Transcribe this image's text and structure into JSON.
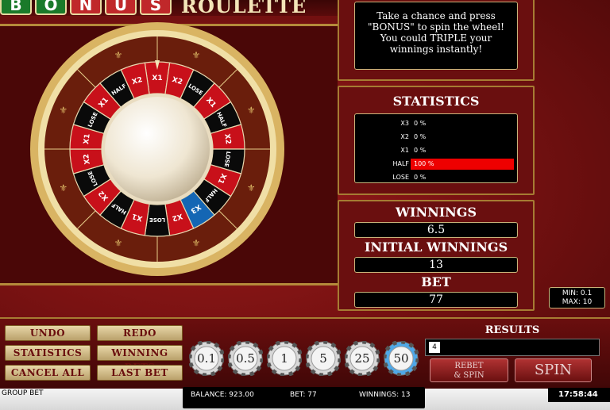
{
  "game": {
    "logo_letters": [
      "B",
      "O",
      "N",
      "U",
      "S"
    ],
    "logo_colors": [
      "#1a7a2a",
      "#1a7a2a",
      "#c0282a",
      "#c0282a",
      "#c0282a"
    ],
    "logo_text": "ROULETTE"
  },
  "wheel": {
    "segments": [
      "X1",
      "X2",
      "LOSE",
      "X1",
      "HALF",
      "X2",
      "LOSE",
      "X1",
      "HALF",
      "X3",
      "X2",
      "LOSE",
      "X1",
      "HALF",
      "X2",
      "LOSE",
      "X2",
      "X1",
      "LOSE",
      "X1",
      "HALF",
      "X2"
    ],
    "colors": {
      "X1": "#c8101a",
      "X2": "#c8101a",
      "X3": "#1466b4",
      "LOSE": "#0a0a0a",
      "HALF": "#0a0a0a"
    }
  },
  "message": "Take a chance and press \"BONUS\" to spin the wheel! You could TRIPLE your winnings instantly!",
  "statistics": {
    "title": "STATISTICS",
    "rows": [
      {
        "label": "X3",
        "value": "0 %",
        "fraction": 0
      },
      {
        "label": "X2",
        "value": "0 %",
        "fraction": 0
      },
      {
        "label": "X1",
        "value": "0 %",
        "fraction": 0
      },
      {
        "label": "HALF",
        "value": "100 %",
        "fraction": 1
      },
      {
        "label": "LOSE",
        "value": "0 %",
        "fraction": 0
      }
    ]
  },
  "winnings": {
    "title": "WINNINGS",
    "value": "6.5",
    "initial_title": "INITIAL WINNINGS",
    "initial_value": "13",
    "bet_title": "BET",
    "bet_value": "77"
  },
  "limits": {
    "min": "MIN: 0.1",
    "max": "MAX: 10"
  },
  "controls": {
    "undo": "UNDO",
    "redo": "REDO",
    "statistics": "STATISTICS",
    "winning_bets": "WINNING BETS",
    "cancel_all": "CANCEL ALL",
    "last_bet": "LAST BET"
  },
  "chips": [
    {
      "label": "0.1",
      "selected": false
    },
    {
      "label": "0.5",
      "selected": false
    },
    {
      "label": "1",
      "selected": false
    },
    {
      "label": "5",
      "selected": false
    },
    {
      "label": "25",
      "selected": false
    },
    {
      "label": "50",
      "selected": true
    }
  ],
  "results": {
    "title": "RESULTS",
    "last": "4"
  },
  "actions": {
    "rebet_line1": "REBET",
    "rebet_line2": "& SPIN",
    "spin": "SPIN"
  },
  "footer": {
    "group_bet": "GROUP BET",
    "balance": "BALANCE: 923.00",
    "bet": "BET: 77",
    "winnings": "WINNINGS: 13",
    "clock": "17:58:44"
  }
}
